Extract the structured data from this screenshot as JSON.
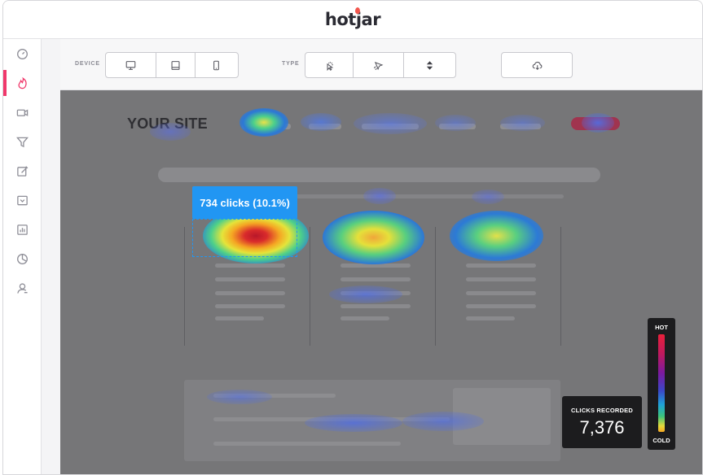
{
  "app": {
    "logo": "hotjar"
  },
  "toolbar": {
    "device_label": "DEVICE",
    "type_label": "TYPE",
    "device_buttons": [
      "desktop",
      "tablet",
      "mobile"
    ],
    "type_buttons": [
      "click",
      "move",
      "scroll"
    ],
    "download_icon": "cloud-download-icon"
  },
  "sidebar": {
    "items": [
      {
        "icon": "dashboard-icon",
        "active": false
      },
      {
        "icon": "heatmap-flame-icon",
        "active": true
      },
      {
        "icon": "recordings-camera-icon",
        "active": false
      },
      {
        "icon": "funnel-icon",
        "active": false
      },
      {
        "icon": "forms-edit-icon",
        "active": false
      },
      {
        "icon": "feedback-poll-icon",
        "active": false
      },
      {
        "icon": "analytics-chart-icon",
        "active": false
      },
      {
        "icon": "survey-pie-icon",
        "active": false
      },
      {
        "icon": "user-icon",
        "active": false
      }
    ]
  },
  "stage": {
    "site_logo": "YOUR SITE",
    "tooltip": "734 clicks (10.1%)"
  },
  "stats": {
    "clicks_label": "CLICKS RECORDED",
    "clicks_value": "7,376"
  },
  "legend": {
    "hot": "HOT",
    "cold": "COLD"
  },
  "colors": {
    "accent": "#f0386b",
    "tooltip": "#2196f3"
  }
}
